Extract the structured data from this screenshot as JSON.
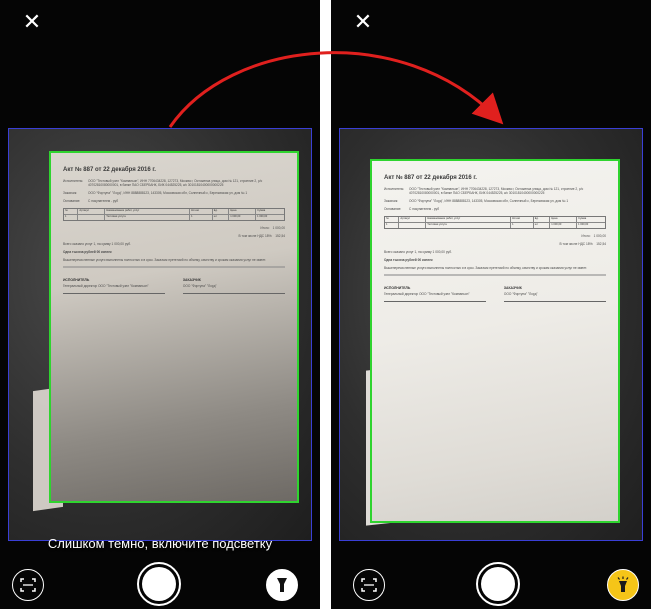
{
  "close_icon": "✕",
  "hint_text": "Слишком темно, включите подсветку",
  "document": {
    "title": "Акт № 887 от 22 декабря 2016 г.",
    "executor_label": "Исполнитель:",
    "executor_text": "ООО \"Тестовый узел \"Компаньон\", ИНН 7706434228, 127273, Москва г, Остоженка улица, дом № 121, строение 2, р/с 40702810080000001, в банке ПАО СБЕРБАНК, БИК 044525225, к/с 30101810400000000225",
    "customer_label": "Заказчик:",
    "customer_text": "ООО \"Фортуна\" \"Лорд\", ИНН 8888888123, 143305, Московская обл, Солнечный с, Березовская ул, дом № 1",
    "basis_label": "Основание:",
    "basis_text": "С покупателем - руб",
    "table_headers": [
      "№",
      "Артикул",
      "Наименование работ, услуг",
      "Кол-во",
      "Ед.",
      "Цена",
      "Сумма"
    ],
    "table_row": [
      "1",
      "",
      "Тестовая услуга",
      "1",
      "шт",
      "1 000,00",
      "1 000,00"
    ],
    "total_label": "Итого:",
    "total_value": "1 000,00",
    "vat_label": "В том числе НДС 18%:",
    "vat_value": "152,54",
    "summary_text": "Всего оказано услуг 1, на сумму 1 000,00 руб.",
    "amount_words": "Одна тысяча рублей 00 копеек",
    "note_text": "Вышеперечисленные услуги выполнены полностью и в срок. Заказчик претензий по объему, качеству и срокам оказания услуг не имеет.",
    "executor_sign": "ИСПОЛНИТЕЛЬ",
    "customer_sign": "ЗАКАЗЧИК",
    "executor_sign_name": "Генеральный директор ООО \"Тестовый узел \"Компаньон\"",
    "customer_sign_name": "ООО \"Фортуна\" \"Лорд\""
  },
  "colors": {
    "frame_blue": "#3a3fd6",
    "detect_green": "#2fd42f",
    "arrow_red": "#e0201e",
    "flash_on": "#f5c518"
  },
  "icons": {
    "scan_mode": "scan-frame-icon",
    "shutter": "shutter-button",
    "flash_off": "flashlight-off-icon",
    "flash_on": "flashlight-on-icon"
  }
}
